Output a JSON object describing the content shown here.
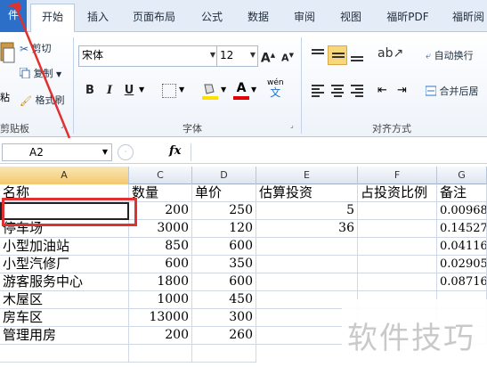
{
  "tabs": [
    "件",
    "开始",
    "插入",
    "页面布局",
    "公式",
    "数据",
    "审阅",
    "视图",
    "福昕PDF",
    "福昕阅"
  ],
  "clipboard": {
    "cut": "剪切",
    "copy": "复制",
    "format_painter": "格式刷",
    "paste": "粘",
    "group_label": "剪贴板"
  },
  "font": {
    "name": "宋体",
    "size": "12",
    "bold": "B",
    "italic": "I",
    "underline": "U",
    "text_color_label": "A",
    "phonetic": "wén",
    "grow": "A",
    "shrink": "A",
    "group_label": "字体"
  },
  "alignment": {
    "wrap": "自动换行",
    "merge": "合并后居",
    "group_label": "对齐方式"
  },
  "formula_bar": {
    "name_box": "A2",
    "fx": "fx",
    "formula": ""
  },
  "columns": [
    "A",
    "C",
    "D",
    "E",
    "F",
    "G"
  ],
  "rows": [
    [
      "名称",
      "数量",
      "单价",
      "估算投资",
      "占投资比例",
      "备注"
    ],
    [
      "",
      "200",
      "250",
      "5",
      "",
      "0.00968"
    ],
    [
      "停车场",
      "3000",
      "120",
      "36",
      "",
      "0.14527"
    ],
    [
      "小型加油站",
      "850",
      "600",
      "",
      "",
      "0.04116"
    ],
    [
      "小型汽修厂",
      "600",
      "350",
      "",
      "",
      "0.02905"
    ],
    [
      "游客服务中心",
      "1800",
      "600",
      "",
      "",
      "0.08716"
    ],
    [
      "木屋区",
      "1000",
      "450",
      "",
      "",
      ""
    ],
    [
      "房车区",
      "13000",
      "300",
      "",
      "",
      ""
    ],
    [
      "管理用房",
      "200",
      "260",
      "",
      "",
      ""
    ]
  ],
  "watermark": "软件技巧",
  "colors": {
    "accent": "#2b6fc9",
    "highlight": "#e03030",
    "selected_header": "#f3c970"
  }
}
